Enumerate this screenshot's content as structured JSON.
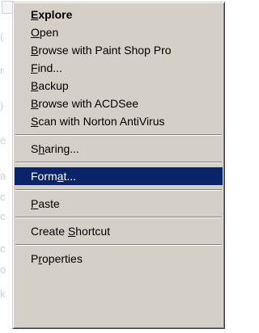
{
  "menu": {
    "groups": [
      [
        {
          "label": "Explore",
          "underline": 0,
          "bold": true
        },
        {
          "label": "Open",
          "underline": 0
        },
        {
          "label": "Browse with Paint Shop Pro",
          "underline": 0
        },
        {
          "label": "Find...",
          "underline": 0
        },
        {
          "label": "Backup",
          "underline": 0
        },
        {
          "label": "Browse with ACDSee",
          "underline": 0
        },
        {
          "label": "Scan with Norton AntiVirus",
          "underline": 0
        }
      ],
      [
        {
          "label": "Sharing...",
          "underline": 1
        }
      ],
      [
        {
          "label": "Format...",
          "underline": 4,
          "selected": true
        }
      ],
      [
        {
          "label": "Paste",
          "underline": 0
        }
      ],
      [
        {
          "label": "Create Shortcut",
          "underline": 7
        }
      ],
      [
        {
          "label": "Properties",
          "underline": 1
        }
      ]
    ]
  },
  "colors": {
    "menu_face": "#d4d0c8",
    "highlight": "#0a246a",
    "highlight_text": "#ffffff"
  }
}
